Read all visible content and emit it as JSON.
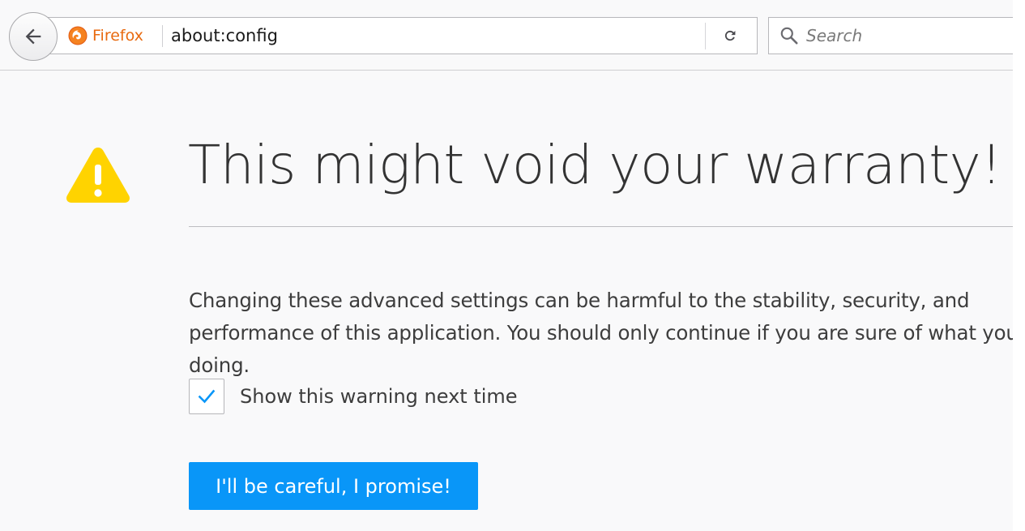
{
  "browser": {
    "identity_label": "Firefox",
    "url": "about:config",
    "search": {
      "placeholder": "Search",
      "value": ""
    },
    "icons": {
      "back": "back-arrow-icon",
      "identity": "firefox-logo-icon",
      "reload": "reload-icon",
      "search": "search-icon"
    }
  },
  "page": {
    "icon": "warning-icon",
    "title": "This might void your warranty!",
    "description": "Changing these advanced settings can be harmful to the stability, security, and performance of this application. You should only continue if you are sure of what you are doing.",
    "show_warning": {
      "label": "Show this warning next time",
      "checked": true
    },
    "accept_button": "I'll be careful, I promise!"
  },
  "colors": {
    "accent": "#0996f8",
    "warning": "#ffd300",
    "firefox_orange": "#e86a10",
    "background": "#f9f9fa",
    "text": "#333333"
  }
}
